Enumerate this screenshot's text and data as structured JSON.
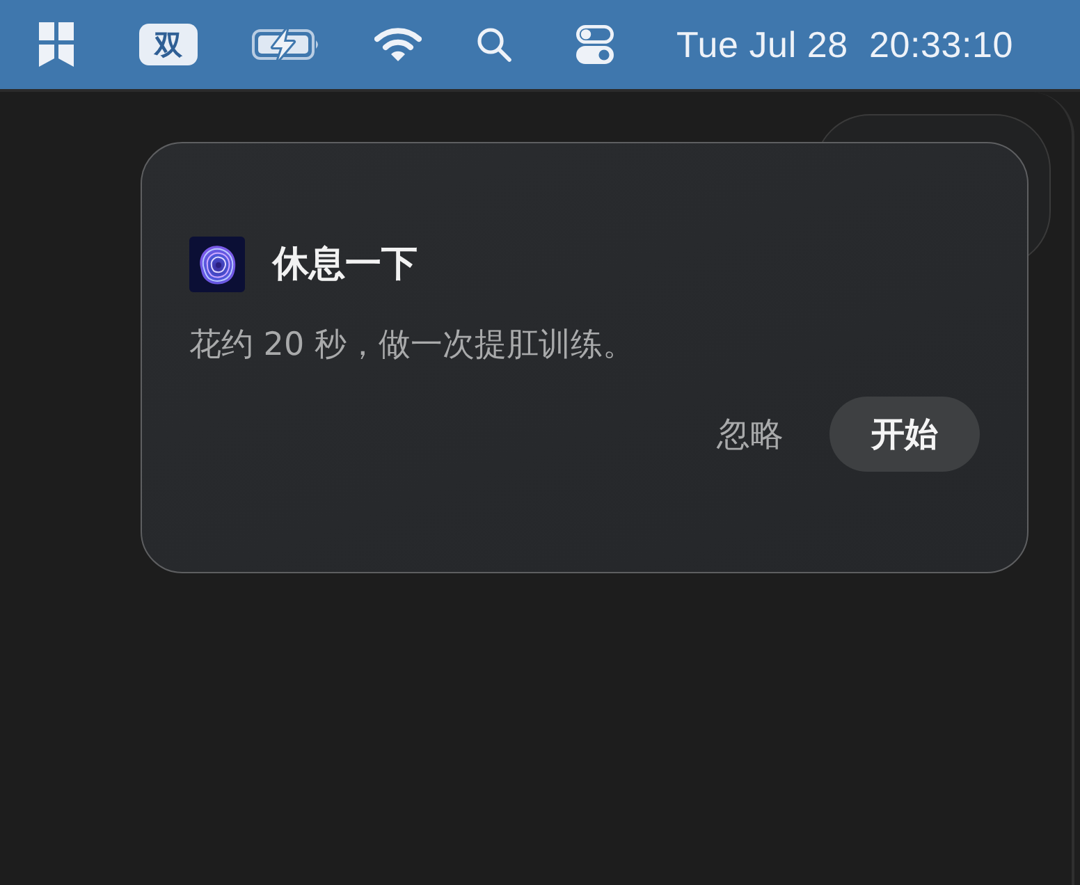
{
  "menu_bar": {
    "input_method": "双",
    "date": "Tue Jul 28",
    "time": "20:33:10"
  },
  "notification": {
    "title": "休息一下",
    "body": "花约 20 秒，做一次提肛训练。",
    "buttons": [
      {
        "label": "忽略",
        "kind": "plain"
      },
      {
        "label": "开始",
        "kind": "filled"
      }
    ]
  }
}
